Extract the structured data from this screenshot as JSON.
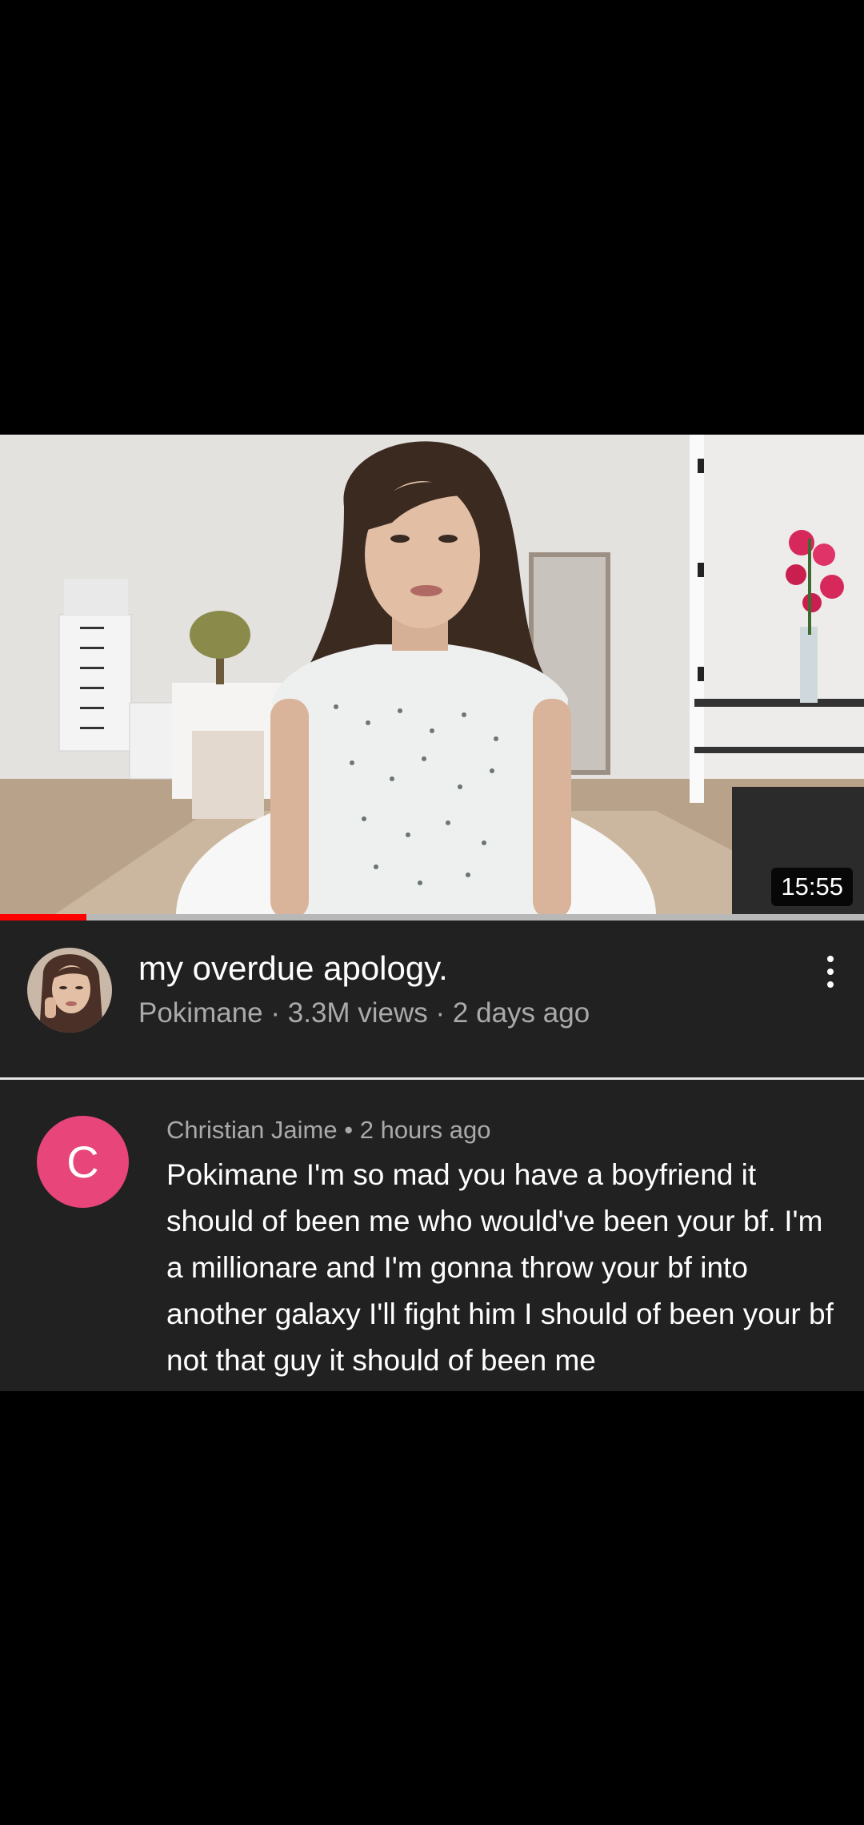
{
  "video": {
    "duration": "15:55",
    "watch_progress": 0.1,
    "title": "my overdue apology.",
    "channel": "Pokimane",
    "views": "3.3M views",
    "age": "2 days ago",
    "more_icon": "more-vert-icon"
  },
  "comment": {
    "avatar_letter": "C",
    "avatar_color": "#e8457a",
    "author": "Christian Jaime",
    "age": "2 hours ago",
    "text": "Pokimane I'm so mad you have a boyfriend it should of been me who would've been your bf. I'm a millionare and I'm gonna throw your bf into another galaxy I'll fight him I should of been your bf not that guy it should of been me"
  },
  "colors": {
    "surface": "#212121",
    "progress": "#ff0000",
    "secondary_text": "#aaaaaa"
  }
}
